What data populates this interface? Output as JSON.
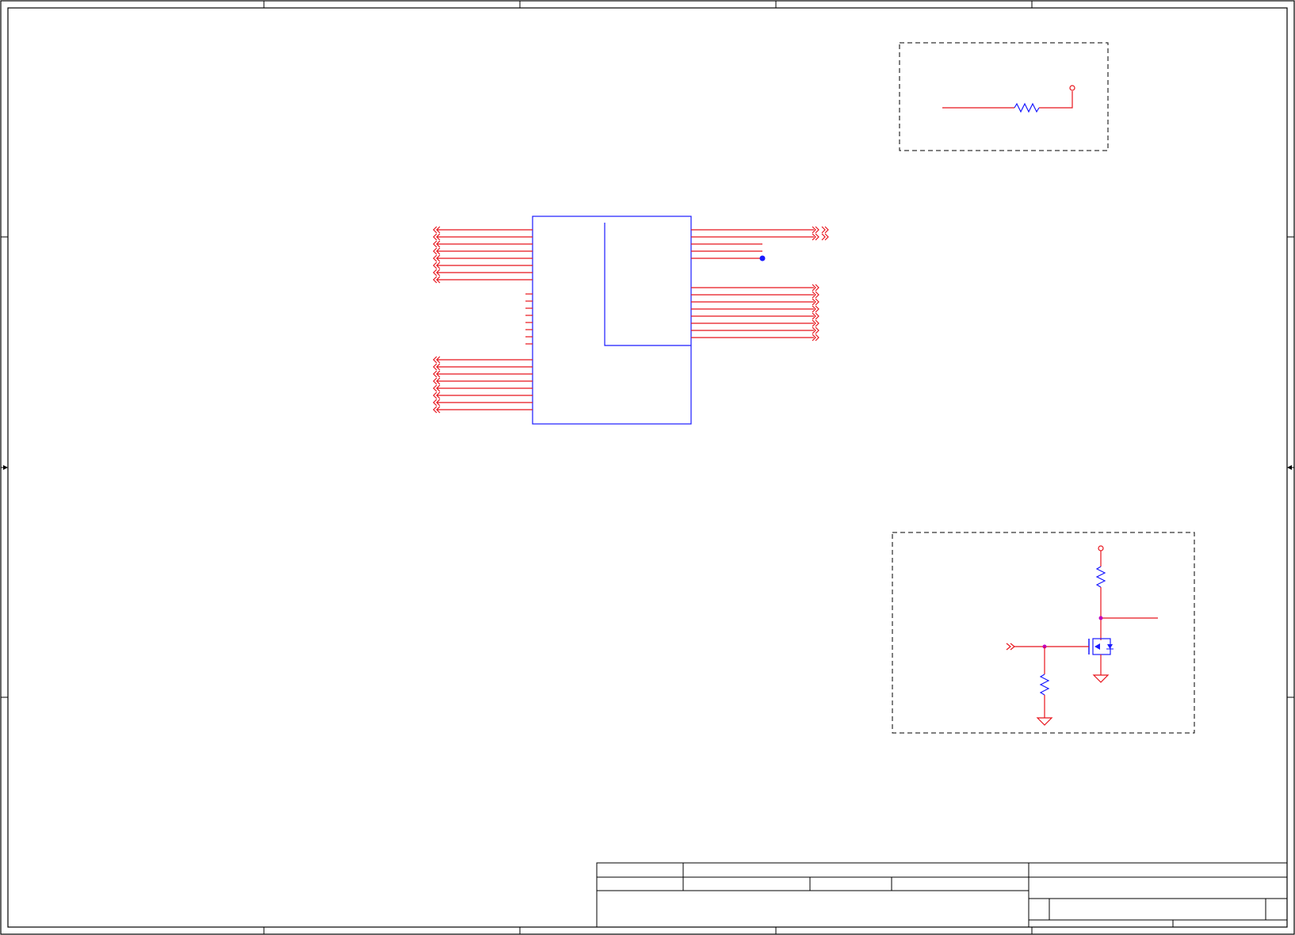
{
  "sheet": {
    "border_color": "#000000",
    "wire_color": "#e8141c",
    "component_color": "#1a1aff",
    "junction_color": "#c000c0",
    "background": "#ffffff"
  },
  "title_block": {
    "fields": []
  },
  "labels": []
}
